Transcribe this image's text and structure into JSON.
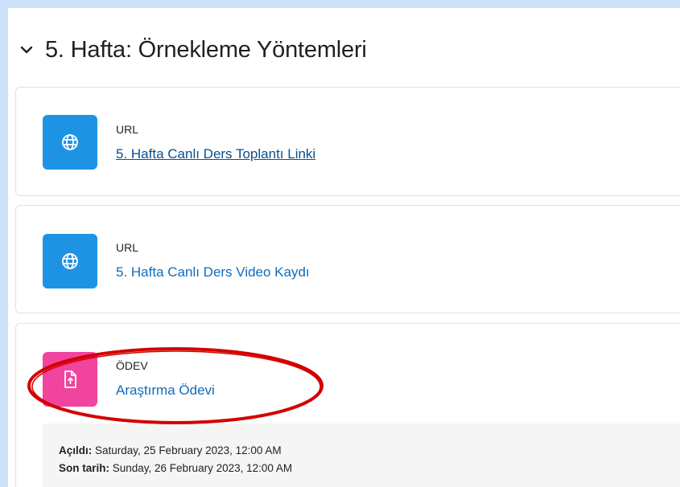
{
  "section": {
    "title": "5. Hafta: Örnekleme Yöntemleri",
    "toggle_icon": "chevron-down-icon"
  },
  "activities": [
    {
      "type": "URL",
      "name": "5. Hafta Canlı Ders Toplantı Linki",
      "icon": "globe-icon",
      "icon_color": "#1f93e3"
    },
    {
      "type": "URL",
      "name": "5. Hafta Canlı Ders Video Kaydı",
      "icon": "globe-icon",
      "icon_color": "#1f93e3"
    },
    {
      "type": "ÖDEV",
      "name": "Araştırma Ödevi",
      "icon": "file-upload-icon",
      "icon_color": "#f0449e",
      "dates": {
        "opened_label": "Açıldı:",
        "opened_value": " Saturday, 25 February 2023, 12:00 AM",
        "due_label": "Son tarih:",
        "due_value": " Sunday, 26 February 2023, 12:00 AM"
      }
    }
  ],
  "colors": {
    "link": "#0f6cbf",
    "annotation": "#d40000"
  }
}
